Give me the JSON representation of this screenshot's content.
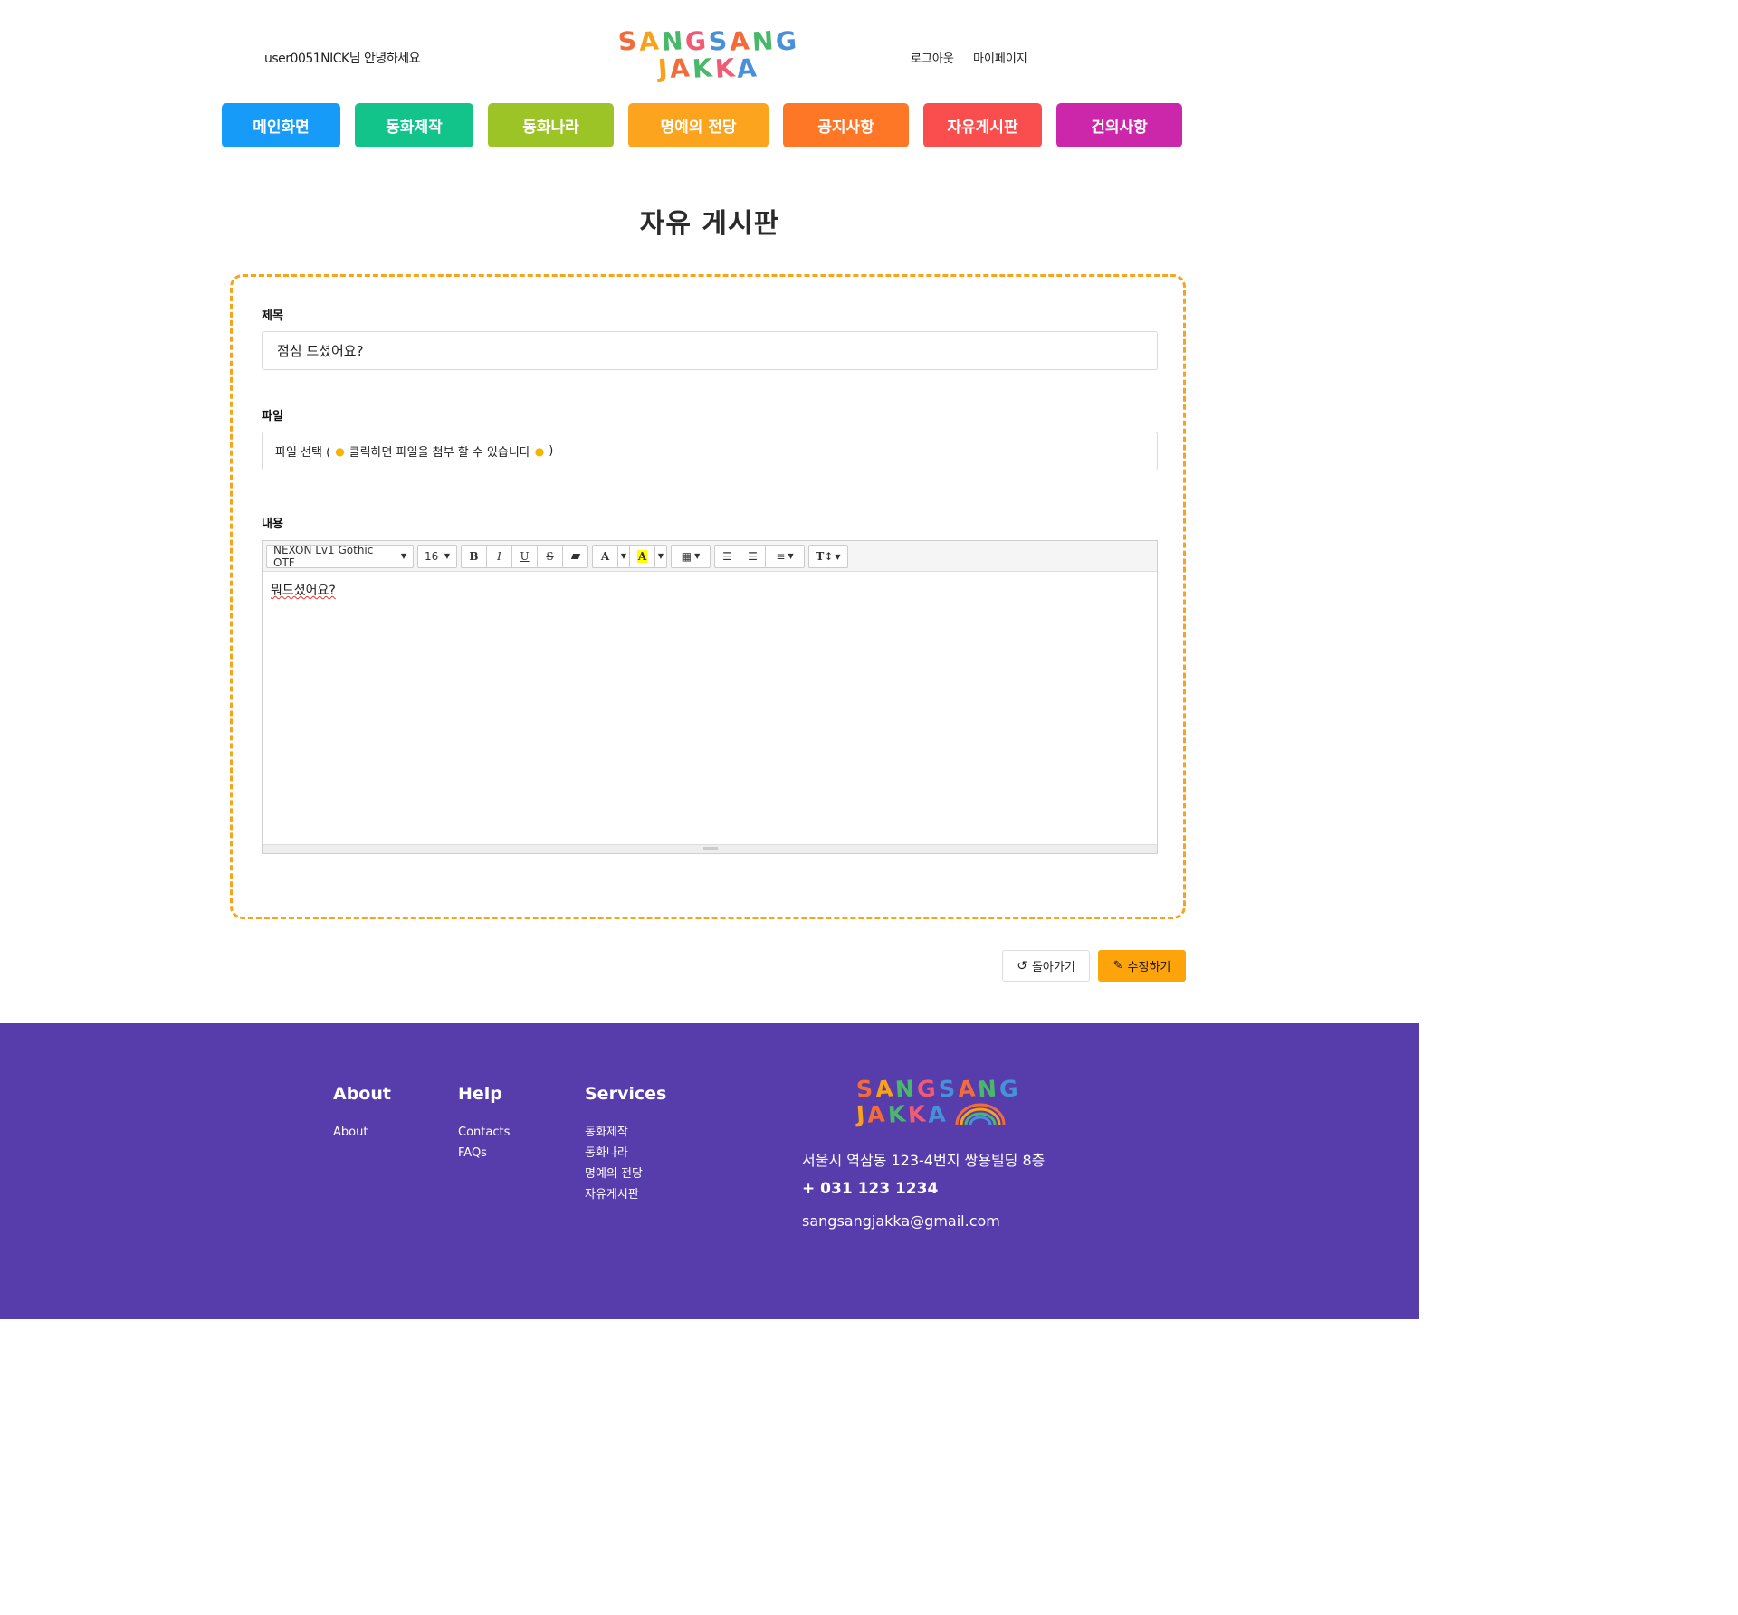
{
  "header": {
    "greeting": "user0051NICK님 안녕하세요",
    "logo_line1": "SANGSANG",
    "logo_line2": "JAKKA",
    "logout": "로그아웃",
    "mypage": "마이페이지"
  },
  "nav": [
    {
      "label": "메인화면",
      "color": "#169cf8"
    },
    {
      "label": "동화제작",
      "color": "#12c38a"
    },
    {
      "label": "동화나라",
      "color": "#9cc427"
    },
    {
      "label": "명예의 전당",
      "color": "#fda41e"
    },
    {
      "label": "공지사항",
      "color": "#fd7727"
    },
    {
      "label": "자유게시판",
      "color": "#fa4e4e"
    },
    {
      "label": "건의사항",
      "color": "#cc27ab"
    }
  ],
  "page_title": "자유 게시판",
  "form": {
    "title_label": "제목",
    "title_value": "점심 드셨어요?",
    "file_label": "파일",
    "file_text_a": "파일 선택 (",
    "file_text_b": "클릭하면 파일을 첨부 할 수 있습니다",
    "file_text_c": ")",
    "content_label": "내용",
    "content_value": "뭐드셨어요?"
  },
  "toolbar": {
    "font": "NEXON Lv1 Gothic OTF",
    "size": "16",
    "bold": "B",
    "italic": "I",
    "underline": "U",
    "strike": "S",
    "color_a": "A",
    "highlight_a": "A",
    "textsize": "T↕"
  },
  "buttons": {
    "back": "돌아가기",
    "edit": "수정하기"
  },
  "footer": {
    "about_title": "About",
    "about_links": [
      "About"
    ],
    "help_title": "Help",
    "help_links": [
      "Contacts",
      "FAQs"
    ],
    "services_title": "Services",
    "services_links": [
      "동화제작",
      "동화나라",
      "명예의 전당",
      "자유게시판"
    ],
    "address": "서울시 역삼동 123-4번지 쌍용빌딩 8층",
    "phone": "+ 031 123 1234",
    "email": "sangsangjakka@gmail.com"
  },
  "colors": {
    "accent": "#fca40a",
    "footer_bg": "#563dab"
  }
}
